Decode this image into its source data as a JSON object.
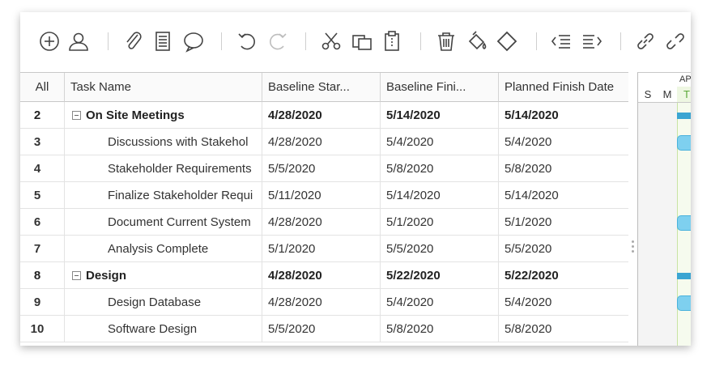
{
  "toolbar": {
    "icons": [
      "add-task-icon",
      "add-resource-icon",
      "attachment-icon",
      "notes-icon",
      "comment-icon",
      "undo-icon",
      "redo-icon",
      "cut-icon",
      "copy-icon",
      "paste-icon",
      "delete-icon",
      "fill-color-icon",
      "milestone-icon",
      "outdent-icon",
      "indent-icon",
      "link-icon",
      "unlink-icon"
    ]
  },
  "grid": {
    "headers": {
      "id": "All",
      "name": "Task Name",
      "baseline_start": "Baseline Star...",
      "baseline_finish": "Baseline Fini...",
      "planned_finish": "Planned Finish Date"
    },
    "rows": [
      {
        "id": "2",
        "name": "On Site Meetings",
        "baseline_start": "4/28/2020",
        "baseline_finish": "5/14/2020",
        "planned_finish": "5/14/2020",
        "summary": true
      },
      {
        "id": "3",
        "name": "Discussions with Stakehol",
        "baseline_start": "4/28/2020",
        "baseline_finish": "5/4/2020",
        "planned_finish": "5/4/2020",
        "summary": false
      },
      {
        "id": "4",
        "name": "Stakeholder Requirements",
        "baseline_start": "5/5/2020",
        "baseline_finish": "5/8/2020",
        "planned_finish": "5/8/2020",
        "summary": false
      },
      {
        "id": "5",
        "name": "Finalize Stakeholder Requi",
        "baseline_start": "5/11/2020",
        "baseline_finish": "5/14/2020",
        "planned_finish": "5/14/2020",
        "summary": false
      },
      {
        "id": "6",
        "name": "Document Current System",
        "baseline_start": "4/28/2020",
        "baseline_finish": "5/1/2020",
        "planned_finish": "5/1/2020",
        "summary": false
      },
      {
        "id": "7",
        "name": "Analysis Complete",
        "baseline_start": "5/1/2020",
        "baseline_finish": "5/5/2020",
        "planned_finish": "5/5/2020",
        "summary": false
      },
      {
        "id": "8",
        "name": "Design",
        "baseline_start": "4/28/2020",
        "baseline_finish": "5/22/2020",
        "planned_finish": "5/22/2020",
        "summary": true
      },
      {
        "id": "9",
        "name": "Design Database",
        "baseline_start": "4/28/2020",
        "baseline_finish": "5/4/2020",
        "planned_finish": "5/4/2020",
        "summary": false
      },
      {
        "id": "10",
        "name": "Software Design",
        "baseline_start": "5/5/2020",
        "baseline_finish": "5/8/2020",
        "planned_finish": "5/8/2020",
        "summary": false
      }
    ]
  },
  "gantt": {
    "month": "AP",
    "days": [
      "S",
      "M",
      "T"
    ],
    "colors": {
      "task_bar": "#7ed0ef",
      "summary_bar": "#3aa5d2",
      "today_col": "#f6fbee",
      "weekend_col": "#f4f4f4"
    }
  }
}
